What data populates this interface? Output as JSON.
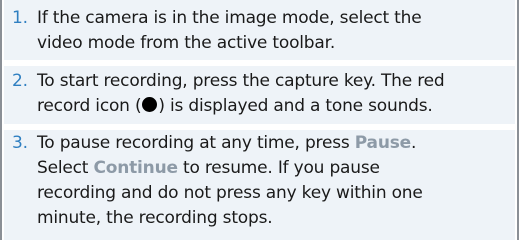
{
  "steps": [
    {
      "number": "1.",
      "line1": "If the camera is in the image mode, select the",
      "line2": "video mode from the active toolbar."
    },
    {
      "number": "2.",
      "line1": "To start recording, press the capture key. The red",
      "line2_before_icon": "record icon (",
      "line2_icon": "record-icon",
      "line2_after_icon": ") is displayed and a tone sounds."
    },
    {
      "number": "3.",
      "line1_before": "To pause recording at any time, press ",
      "pause_label": "Pause",
      "line1_after": ".",
      "line2_before": "Select ",
      "continue_label": "Continue",
      "line2_after": " to resume. If you pause",
      "line3": "recording and do not press any key within one",
      "line4": "minute, the recording stops."
    }
  ],
  "colors": {
    "step_number": "#2f7fc1",
    "ui_key": "#8d9aa7",
    "panel_background": "#eef3f8",
    "frame_border": "#8a8f96"
  }
}
